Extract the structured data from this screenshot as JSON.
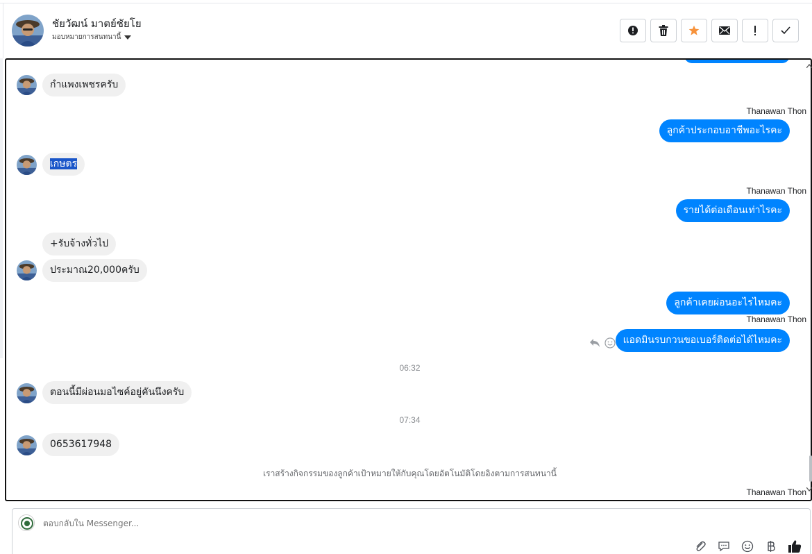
{
  "header": {
    "contact_name": "ชัยวัฒน์ มาตย์ชัยโย",
    "assign_label": "มอบหมายการสนทนานี้"
  },
  "actions": [
    "alert-circle-icon",
    "trash-icon",
    "star-icon",
    "envelope-icon",
    "exclamation-icon",
    "check-icon"
  ],
  "colors": {
    "accent": "#0084ff",
    "star": "#f7923b",
    "highlight": "#1a56c9"
  },
  "messages": {
    "m1": {
      "text": "กำแพงเพชรครับ"
    },
    "s1": {
      "sender": "Thanawan Thon"
    },
    "m2": {
      "text": "ลูกค้าประกอบอาชีพอะไรคะ"
    },
    "m3": {
      "text": "เกษตร"
    },
    "s2": {
      "sender": "Thanawan Thon"
    },
    "m4": {
      "text": "รายได้ต่อเดือนเท่าไรคะ"
    },
    "m5": {
      "text": "+รับจ้างทั่วไป"
    },
    "m6": {
      "text": "ประมาณ20,000ครับ"
    },
    "m7": {
      "text": "ลูกค้าเคยผ่อนอะไรไหมคะ"
    },
    "s3": {
      "sender": "Thanawan Thon"
    },
    "m8": {
      "text": "แอดมินรบกวนขอเบอร์ติดต่อได้ไหมคะ"
    },
    "t1": {
      "text": "06:32"
    },
    "m9": {
      "text": "ตอนนี้มีผ่อนมอไซค์อยู่คันนึงครับ"
    },
    "t2": {
      "text": "07:34"
    },
    "m10": {
      "text": "0653617948"
    },
    "sys1": {
      "text": "เราสร้างกิจกรรมของลูกค้าเป้าหมายให้กับคุณโดยอัตโนมัติโดยอิงตามการสนทนานี้"
    },
    "s4": {
      "sender": "Thanawan Thon"
    }
  },
  "composer": {
    "placeholder": "ตอบกลับใน Messenger...",
    "tools": [
      "paperclip-icon",
      "speech-bubble-icon",
      "emoji-icon",
      "baht-icon",
      "thumbs-up-icon"
    ]
  }
}
